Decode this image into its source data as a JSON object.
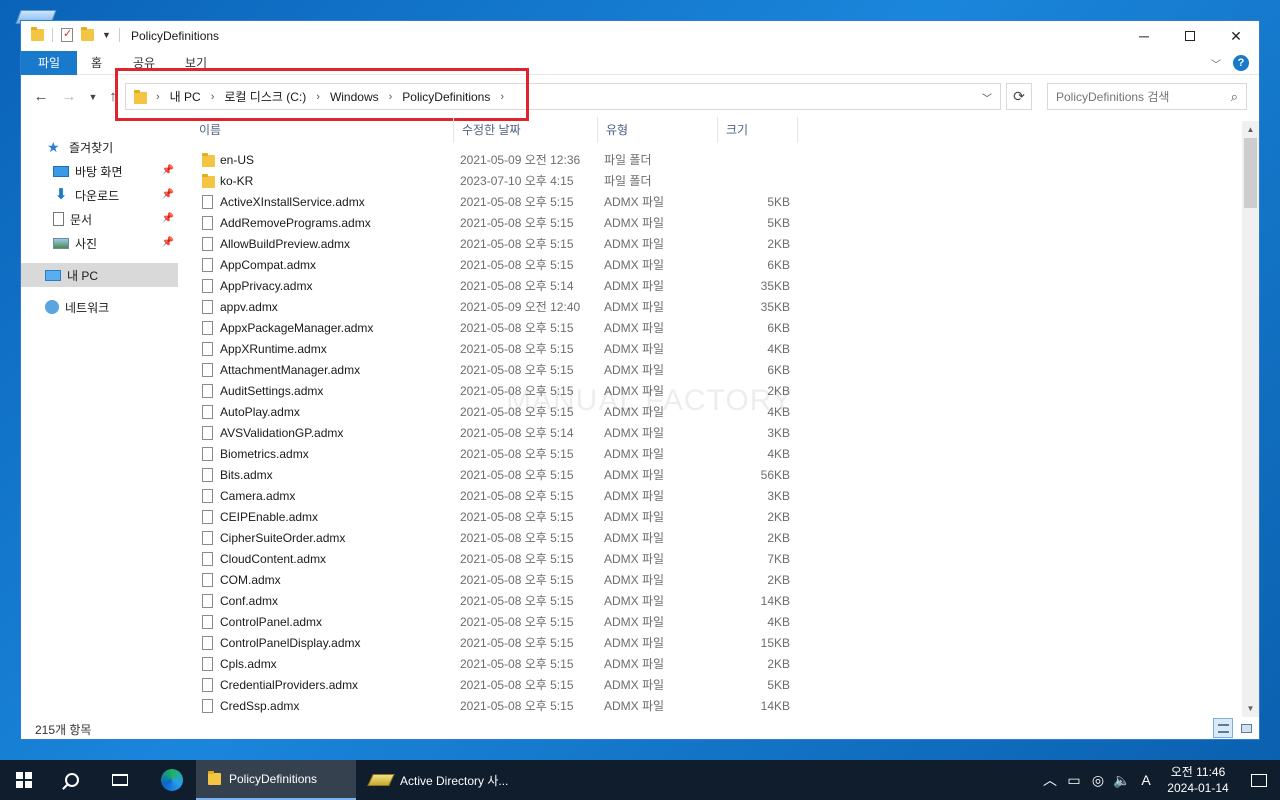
{
  "window": {
    "title": "PolicyDefinitions"
  },
  "ribbon": {
    "tabs": [
      "파일",
      "홈",
      "공유",
      "보기"
    ]
  },
  "address": {
    "crumbs": [
      "내 PC",
      "로컬 디스크 (C:)",
      "Windows",
      "PolicyDefinitions"
    ]
  },
  "search": {
    "placeholder": "PolicyDefinitions 검색"
  },
  "sidebar": {
    "quick_access": "즐겨찾기",
    "items": [
      {
        "label": "바탕 화면",
        "icon": "desktop-icon",
        "pinned": true
      },
      {
        "label": "다운로드",
        "icon": "download-icon",
        "pinned": true
      },
      {
        "label": "문서",
        "icon": "document-icon",
        "pinned": true
      },
      {
        "label": "사진",
        "icon": "picture-icon",
        "pinned": true
      }
    ],
    "this_pc": "내 PC",
    "network": "네트워크"
  },
  "columns": {
    "name": "이름",
    "date": "수정한 날짜",
    "type": "유형",
    "size": "크기"
  },
  "files": [
    {
      "name": "en-US",
      "date": "2021-05-09 오전 12:36",
      "type": "파일 폴더",
      "size": "",
      "kind": "folder"
    },
    {
      "name": "ko-KR",
      "date": "2023-07-10 오후 4:15",
      "type": "파일 폴더",
      "size": "",
      "kind": "folder"
    },
    {
      "name": "ActiveXInstallService.admx",
      "date": "2021-05-08 오후 5:15",
      "type": "ADMX 파일",
      "size": "5KB",
      "kind": "file"
    },
    {
      "name": "AddRemovePrograms.admx",
      "date": "2021-05-08 오후 5:15",
      "type": "ADMX 파일",
      "size": "5KB",
      "kind": "file"
    },
    {
      "name": "AllowBuildPreview.admx",
      "date": "2021-05-08 오후 5:15",
      "type": "ADMX 파일",
      "size": "2KB",
      "kind": "file"
    },
    {
      "name": "AppCompat.admx",
      "date": "2021-05-08 오후 5:15",
      "type": "ADMX 파일",
      "size": "6KB",
      "kind": "file"
    },
    {
      "name": "AppPrivacy.admx",
      "date": "2021-05-08 오후 5:14",
      "type": "ADMX 파일",
      "size": "35KB",
      "kind": "file"
    },
    {
      "name": "appv.admx",
      "date": "2021-05-09 오전 12:40",
      "type": "ADMX 파일",
      "size": "35KB",
      "kind": "file"
    },
    {
      "name": "AppxPackageManager.admx",
      "date": "2021-05-08 오후 5:15",
      "type": "ADMX 파일",
      "size": "6KB",
      "kind": "file"
    },
    {
      "name": "AppXRuntime.admx",
      "date": "2021-05-08 오후 5:15",
      "type": "ADMX 파일",
      "size": "4KB",
      "kind": "file"
    },
    {
      "name": "AttachmentManager.admx",
      "date": "2021-05-08 오후 5:15",
      "type": "ADMX 파일",
      "size": "6KB",
      "kind": "file"
    },
    {
      "name": "AuditSettings.admx",
      "date": "2021-05-08 오후 5:15",
      "type": "ADMX 파일",
      "size": "2KB",
      "kind": "file"
    },
    {
      "name": "AutoPlay.admx",
      "date": "2021-05-08 오후 5:15",
      "type": "ADMX 파일",
      "size": "4KB",
      "kind": "file"
    },
    {
      "name": "AVSValidationGP.admx",
      "date": "2021-05-08 오후 5:14",
      "type": "ADMX 파일",
      "size": "3KB",
      "kind": "file"
    },
    {
      "name": "Biometrics.admx",
      "date": "2021-05-08 오후 5:15",
      "type": "ADMX 파일",
      "size": "4KB",
      "kind": "file"
    },
    {
      "name": "Bits.admx",
      "date": "2021-05-08 오후 5:15",
      "type": "ADMX 파일",
      "size": "56KB",
      "kind": "file"
    },
    {
      "name": "Camera.admx",
      "date": "2021-05-08 오후 5:15",
      "type": "ADMX 파일",
      "size": "3KB",
      "kind": "file"
    },
    {
      "name": "CEIPEnable.admx",
      "date": "2021-05-08 오후 5:15",
      "type": "ADMX 파일",
      "size": "2KB",
      "kind": "file"
    },
    {
      "name": "CipherSuiteOrder.admx",
      "date": "2021-05-08 오후 5:15",
      "type": "ADMX 파일",
      "size": "2KB",
      "kind": "file"
    },
    {
      "name": "CloudContent.admx",
      "date": "2021-05-08 오후 5:15",
      "type": "ADMX 파일",
      "size": "7KB",
      "kind": "file"
    },
    {
      "name": "COM.admx",
      "date": "2021-05-08 오후 5:15",
      "type": "ADMX 파일",
      "size": "2KB",
      "kind": "file"
    },
    {
      "name": "Conf.admx",
      "date": "2021-05-08 오후 5:15",
      "type": "ADMX 파일",
      "size": "14KB",
      "kind": "file"
    },
    {
      "name": "ControlPanel.admx",
      "date": "2021-05-08 오후 5:15",
      "type": "ADMX 파일",
      "size": "4KB",
      "kind": "file"
    },
    {
      "name": "ControlPanelDisplay.admx",
      "date": "2021-05-08 오후 5:15",
      "type": "ADMX 파일",
      "size": "15KB",
      "kind": "file"
    },
    {
      "name": "Cpls.admx",
      "date": "2021-05-08 오후 5:15",
      "type": "ADMX 파일",
      "size": "2KB",
      "kind": "file"
    },
    {
      "name": "CredentialProviders.admx",
      "date": "2021-05-08 오후 5:15",
      "type": "ADMX 파일",
      "size": "5KB",
      "kind": "file"
    },
    {
      "name": "CredSsp.admx",
      "date": "2021-05-08 오후 5:15",
      "type": "ADMX 파일",
      "size": "14KB",
      "kind": "file"
    }
  ],
  "watermark": "MANUAL FACTORY",
  "status": {
    "item_count": "215개 항목"
  },
  "taskbar": {
    "apps": [
      "PolicyDefinitions",
      "Active Directory 사..."
    ],
    "ime": "A",
    "clock_time": "오전 11:46",
    "clock_date": "2024-01-14"
  },
  "colors": {
    "accent": "#1979ca",
    "highlight": "#e0242d",
    "taskbar": "#0f1d2c"
  }
}
